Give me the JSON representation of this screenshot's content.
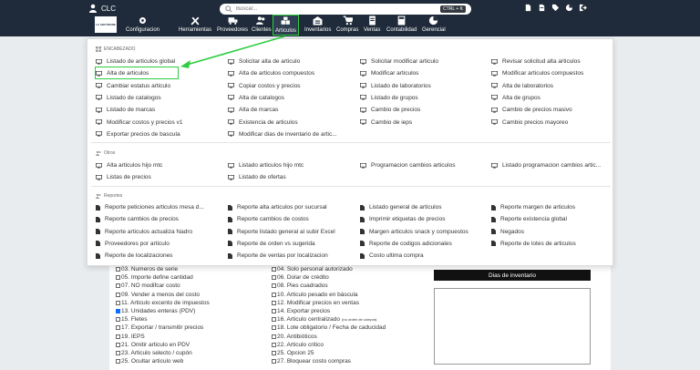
{
  "header": {
    "user_name": "CLC",
    "search_placeholder": "Buscar...",
    "search_shortcut": "CTRL + K",
    "logo_text": "LC SOFTWARE"
  },
  "nav": [
    {
      "label": "Configuracion",
      "icon": "gear-icon"
    },
    {
      "label": "Herramientas",
      "icon": "tools-icon"
    },
    {
      "label": "Proveedores",
      "icon": "truck-icon"
    },
    {
      "label": "Clientes",
      "icon": "users-icon"
    },
    {
      "label": "Articulos",
      "icon": "boxes-icon"
    },
    {
      "label": "Inventarios",
      "icon": "warehouse-icon"
    },
    {
      "label": "Compras",
      "icon": "cart-icon"
    },
    {
      "label": "Ventas",
      "icon": "receipt-icon"
    },
    {
      "label": "Contabilidad",
      "icon": "calculator-icon"
    },
    {
      "label": "Gerencial",
      "icon": "pie-chart-icon"
    }
  ],
  "menu": {
    "encabezado_title": "ENCABEZADO",
    "encabezado": [
      [
        "Listado de articulos global",
        "Solicitar alta de articulo",
        "Solicitar modificar articulo",
        "Revisar solicitud alta articulos"
      ],
      [
        "Alta de articulos",
        "Alta de articulos compuestos",
        "Modificar articulos",
        "Modificar articulos compuestos"
      ],
      [
        "Cambiar estatus articulo",
        "Copiar costos y precios",
        "Listado de laboratorios",
        "Alta de laboratorios"
      ],
      [
        "Listado de catalogos",
        "Alta de catalogos",
        "Listado de grupos",
        "Alta de grupos"
      ],
      [
        "Listado de marcas",
        "Alta de marcas",
        "Cambio de precios",
        "Cambio de precios masivo"
      ],
      [
        "Modificar costos y precios v1",
        "Existencia de articulos",
        "Cambio de ieps",
        "Cambio precios mayoreo"
      ],
      [
        "Exportar precios de bascula",
        "Modificar dias de inventario de artic..."
      ]
    ],
    "otros_title": "Otros",
    "otros": [
      [
        "Alta articulos hijo mtc",
        "Listado articulos hijo mtc",
        "Programacion cambios articulos",
        "Listado programacion cambios artic..."
      ],
      [
        "Listas de precios",
        "Listado de ofertas"
      ]
    ],
    "reportes_title": "Reportes",
    "reportes": [
      [
        "Reporte peticiones articulos mesa d...",
        "Reporte alta articulos por sucursal",
        "Listado general de articulos",
        "Reporte margen de articulos"
      ],
      [
        "Reporte cambios de precios",
        "Reporte cambios de costos",
        "Imprimir etiquetas de precios",
        "Reporte existencia global"
      ],
      [
        "Reporte articulos actualiza Nadro",
        "Reporte listado general al subir Excel",
        "Margen articulos snack y compuestos",
        "Negados"
      ],
      [
        "Proveedores por articulo",
        "Reporte de orden vs sugerida",
        "Reporte de codigos adicionales",
        "Reporte de lotes de articulos"
      ],
      [
        "Reporte de localizaciones",
        "Reporte de ventas por localizacion",
        "Costo ultima compra"
      ]
    ]
  },
  "form": {
    "left": [
      {
        "label": "03. Numeros de serie",
        "checked": false
      },
      {
        "label": "05. Importe define cantidad",
        "checked": false
      },
      {
        "label": "07. NO modifcar costo",
        "checked": false
      },
      {
        "label": "09. Vender a menos del costo",
        "checked": false
      },
      {
        "label": "11. Articulo excento de impuestos",
        "checked": false
      },
      {
        "label": "13. Unidades enteras (PDV)",
        "checked": true
      },
      {
        "label": "15. Fletes",
        "checked": false
      },
      {
        "label": "17. Exportar / transmitir precios",
        "checked": false
      },
      {
        "label": "19. IEPS",
        "checked": false
      },
      {
        "label": "21. Omitir articulo en PDV",
        "checked": false
      },
      {
        "label": "23. Articulo selecto / cupón",
        "checked": false
      },
      {
        "label": "25. Ocultar articulo web",
        "checked": false
      }
    ],
    "right": [
      {
        "label": "04. Solo personal autorizado",
        "checked": false
      },
      {
        "label": "06. Dolar de crédito",
        "checked": false
      },
      {
        "label": "08. Pies cuadrados",
        "checked": false
      },
      {
        "label": "10. Articulo pesado en báscula",
        "checked": false
      },
      {
        "label": "12. Modificar precios en ventas",
        "checked": false
      },
      {
        "label": "14. Exportar precios",
        "checked": false
      },
      {
        "label": "16. Articulo centralizado",
        "checked": false,
        "note": "(no orden de compra)"
      },
      {
        "label": "18. Lote obligatorio / Fecha de caducidad",
        "checked": false
      },
      {
        "label": "20. Antibióticos",
        "checked": false
      },
      {
        "label": "22. Articulo critico",
        "checked": false
      },
      {
        "label": "25. Opcion 25",
        "checked": false
      },
      {
        "label": "27. Bloquear costo compras",
        "checked": false
      }
    ],
    "inventory_title": "Dias de inventario"
  },
  "colors": {
    "topbar": "#1f2b3a",
    "highlight": "#2ecc40"
  }
}
